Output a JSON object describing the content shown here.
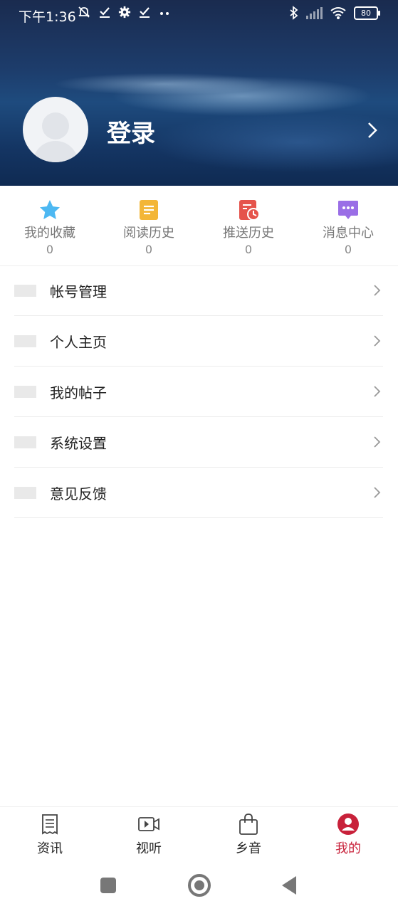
{
  "status_bar": {
    "time": "下午1:36",
    "left_icons": [
      "notification-muted-icon",
      "check-icon",
      "gear-icon",
      "check-icon",
      "more-dots-icon"
    ],
    "battery": "80"
  },
  "profile": {
    "login_label": "登录"
  },
  "stats": [
    {
      "label": "我的收藏",
      "count": "0",
      "icon": "star-icon",
      "color": "#4db8f2"
    },
    {
      "label": "阅读历史",
      "count": "0",
      "icon": "document-icon",
      "color": "#f3b637"
    },
    {
      "label": "推送历史",
      "count": "0",
      "icon": "push-history-icon",
      "color": "#e5534b"
    },
    {
      "label": "消息中心",
      "count": "0",
      "icon": "message-icon",
      "color": "#9a6ee6"
    }
  ],
  "menu": [
    {
      "label": "帐号管理"
    },
    {
      "label": "个人主页"
    },
    {
      "label": "我的帖子"
    },
    {
      "label": "系统设置"
    },
    {
      "label": "意见反馈"
    }
  ],
  "bottom_nav": [
    {
      "label": "资讯",
      "icon": "news-icon",
      "active": false
    },
    {
      "label": "视听",
      "icon": "video-icon",
      "active": false
    },
    {
      "label": "乡音",
      "icon": "bag-icon",
      "active": false
    },
    {
      "label": "我的",
      "icon": "profile-icon",
      "active": true
    }
  ],
  "colors": {
    "active_tab": "#c8213a",
    "header_bg": "#1d3d6c"
  }
}
